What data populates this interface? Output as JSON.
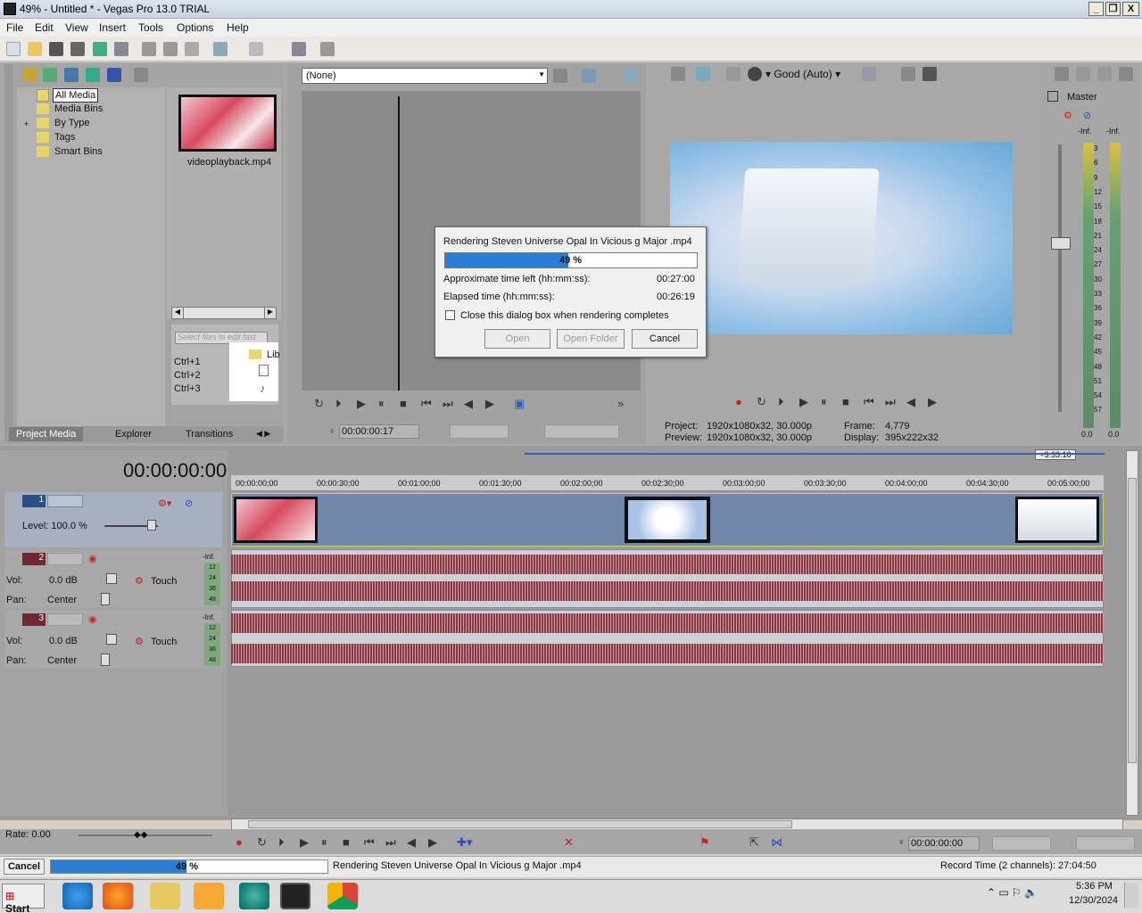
{
  "window": {
    "title": "49% - Untitled * - Vegas Pro 13.0 TRIAL",
    "minimize": "_",
    "maximize": "❐",
    "close": "X"
  },
  "menu": [
    "File",
    "Edit",
    "View",
    "Insert",
    "Tools",
    "Options",
    "Help"
  ],
  "explorer_tree": {
    "items": [
      "All Media",
      "Media Bins",
      "By Type",
      "Tags",
      "Smart Bins"
    ],
    "expander": "+"
  },
  "media": {
    "filename": "videoplayback.mp4",
    "search_placeholder": "Select files to edit fast",
    "shortcuts": [
      "Ctrl+1",
      "Ctrl+2",
      "Ctrl+3"
    ],
    "lib_label": "Lib"
  },
  "left_tabs": [
    "Project Media",
    "Explorer",
    "Transitions"
  ],
  "trimmer": {
    "preset": "(None)",
    "timecode": "00:00:00:17"
  },
  "preview": {
    "quality": "Good (Auto)",
    "project_label": "Project:",
    "project_value": "1920x1080x32, 30.000p",
    "preview_label": "Preview:",
    "preview_value": "1920x1080x32, 30.000p",
    "frame_label": "Frame:",
    "frame_value": "4,779",
    "display_label": "Display:",
    "display_value": "395x222x32"
  },
  "master": {
    "label": "Master",
    "inf_left": "-Inf.",
    "inf_right": "-Inf.",
    "scale": [
      "3",
      "6",
      "9",
      "12",
      "15",
      "18",
      "21",
      "24",
      "27",
      "30",
      "33",
      "36",
      "39",
      "42",
      "45",
      "48",
      "51",
      "54",
      "57"
    ],
    "bottom_left": "0.0",
    "bottom_right": "0.0"
  },
  "dialog": {
    "title": "Rendering Steven Universe Opal In Vicious g Major .mp4",
    "progress_percent": 49,
    "progress_text": "49 %",
    "time_left_label": "Approximate time left (hh:mm:ss):",
    "time_left_value": "00:27:00",
    "elapsed_label": "Elapsed time (hh:mm:ss):",
    "elapsed_value": "00:26:19",
    "close_checkbox": "Close this dialog box when rendering completes",
    "btn_open": "Open",
    "btn_open_folder": "Open Folder",
    "btn_cancel": "Cancel"
  },
  "timeline": {
    "cursor_time": "00:00:00:00",
    "end_marker": "+3:33:18",
    "ruler": [
      "00:00:00;00",
      "00:00:30;00",
      "00:01:00;00",
      "00:01:30;00",
      "00:02:00;00",
      "00:02:30;00",
      "00:03:00;00",
      "00:03:30;00",
      "00:04:00;00",
      "00:04:30;00",
      "00:05:00;00"
    ],
    "tracks": [
      {
        "num": "1",
        "level_label": "Level: 100.0 %"
      },
      {
        "num": "2",
        "vol_label": "Vol:",
        "vol_value": "0.0 dB",
        "pan_label": "Pan:",
        "pan_value": "Center",
        "mode": "Touch",
        "inf": "-Inf.",
        "meter": [
          "12",
          "24",
          "36",
          "48"
        ]
      },
      {
        "num": "3",
        "vol_label": "Vol:",
        "vol_value": "0.0 dB",
        "pan_label": "Pan:",
        "pan_value": "Center",
        "mode": "Touch",
        "inf": "-Inf.",
        "meter": [
          "12",
          "24",
          "36",
          "48"
        ]
      }
    ],
    "rate": "Rate: 0.00",
    "transport_time": "00:00:00:00"
  },
  "statusbar": {
    "cancel": "Cancel",
    "progress_percent": 49,
    "progress_text": "49 %",
    "message": "Rendering Steven Universe Opal In Vicious g Major .mp4",
    "record_time": "Record Time (2 channels): 27:04:50"
  },
  "taskbar": {
    "start": "Start",
    "time": "5:36 PM",
    "date": "12/30/2024"
  },
  "colors": {
    "progress": "#2a7fd4",
    "waveform": "#8b3a44",
    "video_track": "#6f87a8"
  }
}
